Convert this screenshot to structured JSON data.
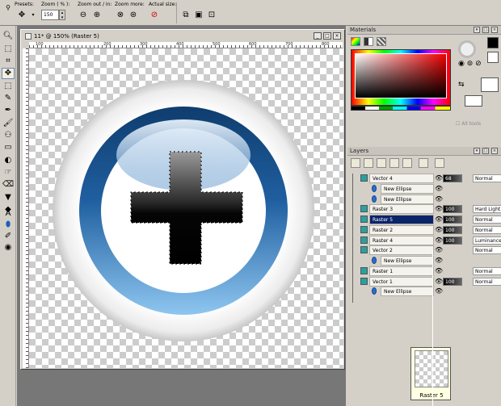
{
  "toolbar": {
    "presets_label": "Presets:",
    "zoom_label": "Zoom ( % ):",
    "zoom_value": "150",
    "zoom_out_label": "Zoom out / in:",
    "zoom_more_label": "Zoom more:",
    "actual_size_label": "Actual size:"
  },
  "document": {
    "title": "11* @ 150% (Raster 5)",
    "ruler_marks": [
      "100",
      "200",
      "300",
      "400",
      "500",
      "600",
      "700",
      "800",
      "900"
    ]
  },
  "materials": {
    "title": "Materials",
    "all_tools_label": "All tools"
  },
  "layers": {
    "title": "Layers",
    "rows": [
      {
        "name": "Vector 4",
        "kind": "vector",
        "indent": 0,
        "opacity": "68",
        "blend": "Normal",
        "selected": false
      },
      {
        "name": "New Ellipse",
        "kind": "shape",
        "indent": 1,
        "opacity": "",
        "blend": "",
        "selected": false
      },
      {
        "name": "New Ellipse",
        "kind": "shape",
        "indent": 1,
        "opacity": "",
        "blend": "",
        "selected": false
      },
      {
        "name": "Raster 3",
        "kind": "raster",
        "indent": 0,
        "opacity": "100",
        "blend": "Hard Light",
        "selected": false
      },
      {
        "name": "Raster 5",
        "kind": "raster",
        "indent": 0,
        "opacity": "100",
        "blend": "Normal",
        "selected": true
      },
      {
        "name": "Raster 2",
        "kind": "raster",
        "indent": 0,
        "opacity": "100",
        "blend": "Normal",
        "selected": false
      },
      {
        "name": "Raster 4",
        "kind": "raster",
        "indent": 0,
        "opacity": "100",
        "blend": "Luminance (L)",
        "selected": false
      },
      {
        "name": "Vector 2",
        "kind": "vector",
        "indent": 0,
        "opacity": "",
        "blend": "Normal",
        "selected": false
      },
      {
        "name": "New Ellipse",
        "kind": "shape",
        "indent": 1,
        "opacity": "",
        "blend": "",
        "selected": false
      },
      {
        "name": "Raster 1",
        "kind": "raster",
        "indent": 0,
        "opacity": "",
        "blend": "Normal",
        "selected": false
      },
      {
        "name": "Vector 1",
        "kind": "vector",
        "indent": 0,
        "opacity": "100",
        "blend": "Normal",
        "selected": false
      },
      {
        "name": "New Ellipse",
        "kind": "shape",
        "indent": 1,
        "opacity": "",
        "blend": "",
        "selected": false
      }
    ],
    "tooltip": "Raster 5"
  },
  "colors": {
    "panel": "#d4d0c8",
    "workspace": "#777777",
    "selection": "#0a246a",
    "ring_blue": "#1f5fa0",
    "ring_light": "#8ec6f0"
  },
  "icons": {
    "tools": [
      "zoom-icon",
      "deform-icon",
      "crop-icon",
      "move-icon",
      "selection-icon",
      "freehand-selection-icon",
      "dropper-icon",
      "paint-brush-icon",
      "clone-brush-icon",
      "scratch-remover-icon",
      "dodge-icon",
      "smudge-icon",
      "eraser-icon",
      "fill-icon",
      "text-icon",
      "ellipse-icon",
      "pen-icon",
      "red-eye-icon"
    ]
  }
}
